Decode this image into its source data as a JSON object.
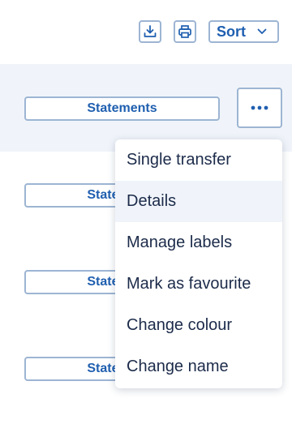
{
  "toolbar": {
    "download_icon": "download-icon",
    "print_icon": "print-icon",
    "sort_label": "Sort",
    "sort_chevron_icon": "chevron-down-icon"
  },
  "rows": [
    {
      "button_label": "Statements"
    },
    {
      "button_label": "Statements"
    },
    {
      "button_label": "Statements"
    },
    {
      "button_label": "Statements"
    }
  ],
  "more_button_icon": "more-horizontal-icon",
  "context_menu": {
    "items": [
      {
        "label": "Single transfer"
      },
      {
        "label": "Details"
      },
      {
        "label": "Manage labels"
      },
      {
        "label": "Mark as favourite"
      },
      {
        "label": "Change colour"
      },
      {
        "label": "Change name"
      }
    ]
  },
  "colors": {
    "accent": "#1f5fb0",
    "border": "#9db5d3",
    "row_highlight": "#f0f4fa",
    "menu_text": "#1c2b4a"
  }
}
